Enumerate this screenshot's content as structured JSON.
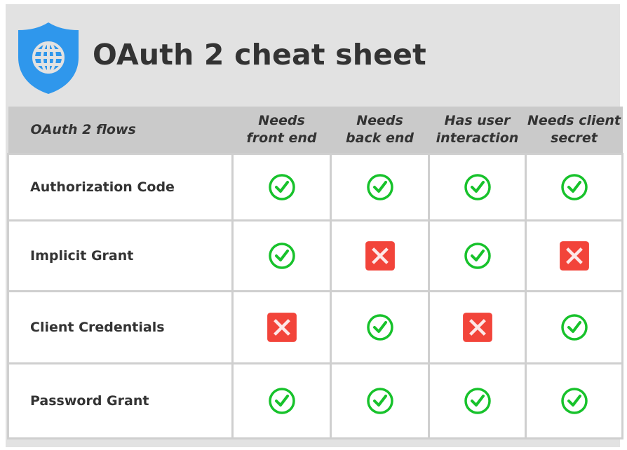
{
  "header": {
    "title": "OAuth 2 cheat sheet",
    "logo_icon": "shield-globe-icon"
  },
  "colors": {
    "shield": "#2f97ec",
    "check": "#17c22b",
    "cross_bg": "#f2443a",
    "header_bg": "#e2e2e2",
    "table_head_bg": "#cacaca",
    "text": "#333333"
  },
  "table": {
    "columns": [
      "OAuth 2 flows",
      "Needs front end",
      "Needs back end",
      "Has user interaction",
      "Needs client secret"
    ],
    "column_lines": [
      [
        "OAuth 2 flows"
      ],
      [
        "Needs",
        "front end"
      ],
      [
        "Needs",
        "back end"
      ],
      [
        "Has user",
        "interaction"
      ],
      [
        "Needs client",
        "secret"
      ]
    ],
    "rows": [
      {
        "flow": "Authorization Code",
        "values": [
          true,
          true,
          true,
          true
        ]
      },
      {
        "flow": "Implicit Grant",
        "values": [
          true,
          false,
          true,
          false
        ]
      },
      {
        "flow": "Client Credentials",
        "values": [
          false,
          true,
          false,
          true
        ]
      },
      {
        "flow": "Password Grant",
        "values": [
          true,
          true,
          true,
          true
        ]
      }
    ],
    "icons": {
      "yes": "check-circle-icon",
      "no": "x-square-icon"
    }
  }
}
